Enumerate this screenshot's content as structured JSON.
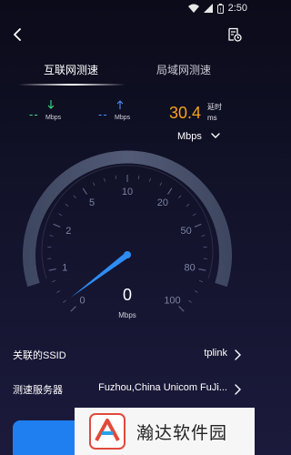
{
  "status_bar": {
    "time": "2:50"
  },
  "colors": {
    "download": "#35e07c",
    "upload": "#4c8df6",
    "latency": "#f4a21c",
    "needle": "#2e8df5",
    "start_button": "#1f7ff0"
  },
  "header": {
    "back_icon": "back-arrow-icon",
    "history_icon": "history-clock-icon"
  },
  "tabs": [
    {
      "label": "互联网测速",
      "active": true
    },
    {
      "label": "局域网测速",
      "active": false
    }
  ],
  "download": {
    "value": "--",
    "unit": "Mbps",
    "icon": "arrow-down-icon"
  },
  "upload": {
    "value": "--",
    "unit": "Mbps",
    "icon": "arrow-up-icon"
  },
  "latency": {
    "value": "30.4",
    "label": "延时",
    "unit": "ms"
  },
  "unit_selector": {
    "value": "Mbps"
  },
  "gauge": {
    "ticks": [
      "0",
      "1",
      "2",
      "5",
      "10",
      "20",
      "50",
      "80",
      "100"
    ],
    "current_value": "0",
    "unit": "Mbps"
  },
  "info": {
    "ssid_label": "关联的SSID",
    "ssid_value": "tplink",
    "server_label": "测速服务器",
    "server_value": "Fuzhou,China Unicom FuJi..."
  },
  "watermark": {
    "text": "瀚达软件园"
  }
}
